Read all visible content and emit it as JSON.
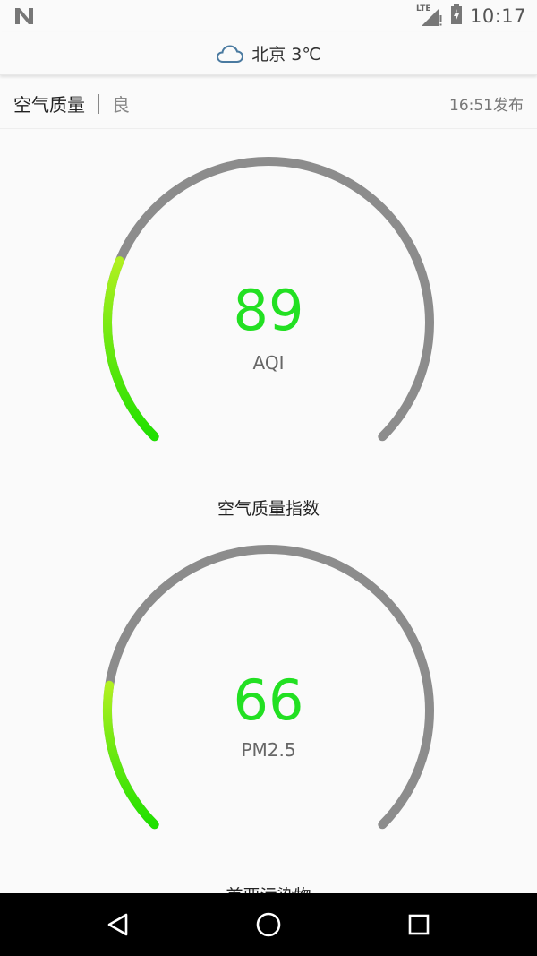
{
  "status_bar": {
    "time": "10:17",
    "network": "LTE",
    "icons": [
      "notification-n-icon",
      "signal-icon",
      "battery-icon"
    ]
  },
  "top_bar": {
    "icon": "cloud-icon",
    "city_temp": "北京 3℃"
  },
  "air_quality": {
    "title": "空气质量",
    "level": "良",
    "published": "16:51发布"
  },
  "gauges": [
    {
      "value": "89",
      "unit": "AQI",
      "caption": "空气质量指数",
      "fill_fraction": 0.25
    },
    {
      "value": "66",
      "unit": "PM2.5",
      "caption": "首要污染物",
      "fill_fraction": 0.2
    }
  ],
  "colors": {
    "accent_green": "#22e022",
    "track_gray": "#8c8c8c"
  },
  "nav": {
    "icons": [
      "back-icon",
      "home-icon",
      "recents-icon"
    ]
  }
}
